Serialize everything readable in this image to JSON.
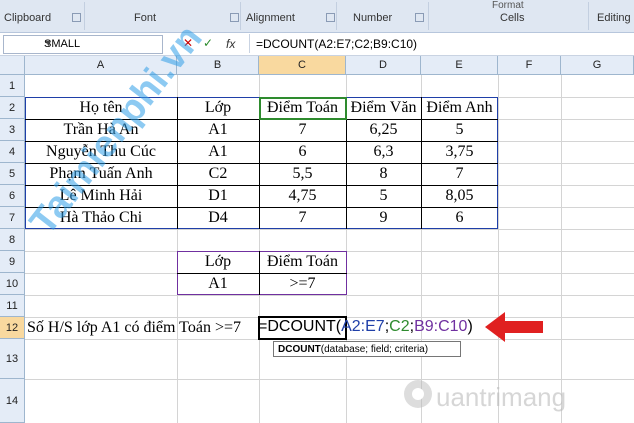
{
  "ribbon": {
    "groups": [
      "Clipboard",
      "Font",
      "Alignment",
      "Number",
      "Cells",
      "Editing"
    ],
    "top_partial": "Format"
  },
  "formula_bar": {
    "name_box": "SMALL",
    "fx": "fx",
    "cancel": "✕",
    "enter": "✓",
    "formula": "=DCOUNT(A2:E7;C2;B9:C10)"
  },
  "columns": [
    "A",
    "B",
    "C",
    "D",
    "E",
    "F",
    "G"
  ],
  "rows": [
    "1",
    "2",
    "3",
    "4",
    "5",
    "6",
    "7",
    "8",
    "9",
    "10",
    "11",
    "12",
    "13",
    "14"
  ],
  "table": {
    "headers": [
      "Họ tên",
      "Lớp",
      "Điểm Toán",
      "Điểm Văn",
      "Điểm Anh"
    ],
    "rows": [
      [
        "Trần Hà An",
        "A1",
        "7",
        "6,25",
        "5"
      ],
      [
        "Nguyễn Thu Cúc",
        "A1",
        "6",
        "6,3",
        "3,75"
      ],
      [
        "Phạm Tuấn Anh",
        "C2",
        "5,5",
        "8",
        "7"
      ],
      [
        "Lê Minh Hải",
        "D1",
        "4,75",
        "5",
        "8,05"
      ],
      [
        "Hà Thảo Chi",
        "D4",
        "7",
        "9",
        "6"
      ]
    ]
  },
  "criteria": {
    "headers": [
      "Lớp",
      "Điểm Toán"
    ],
    "values": [
      "A1",
      ">=7"
    ]
  },
  "row12": {
    "label": "Số H/S lớp A1 có điểm Toán >=7",
    "formula_parts": [
      "=DCOUNT(",
      "A2:E7",
      ";",
      "C2",
      ";",
      "B9:C10",
      ")"
    ]
  },
  "tooltip": {
    "func": "DCOUNT",
    "args": "(database; field; criteria)"
  },
  "watermarks": [
    "Taimienphi.vn",
    "uantrimang"
  ],
  "colors": {
    "range_blue": "#1f3fa8",
    "range_green": "#2e8b2e",
    "range_purple": "#7030a0",
    "arrow_red": "#e02020",
    "selected_header": "#f9d99f"
  }
}
